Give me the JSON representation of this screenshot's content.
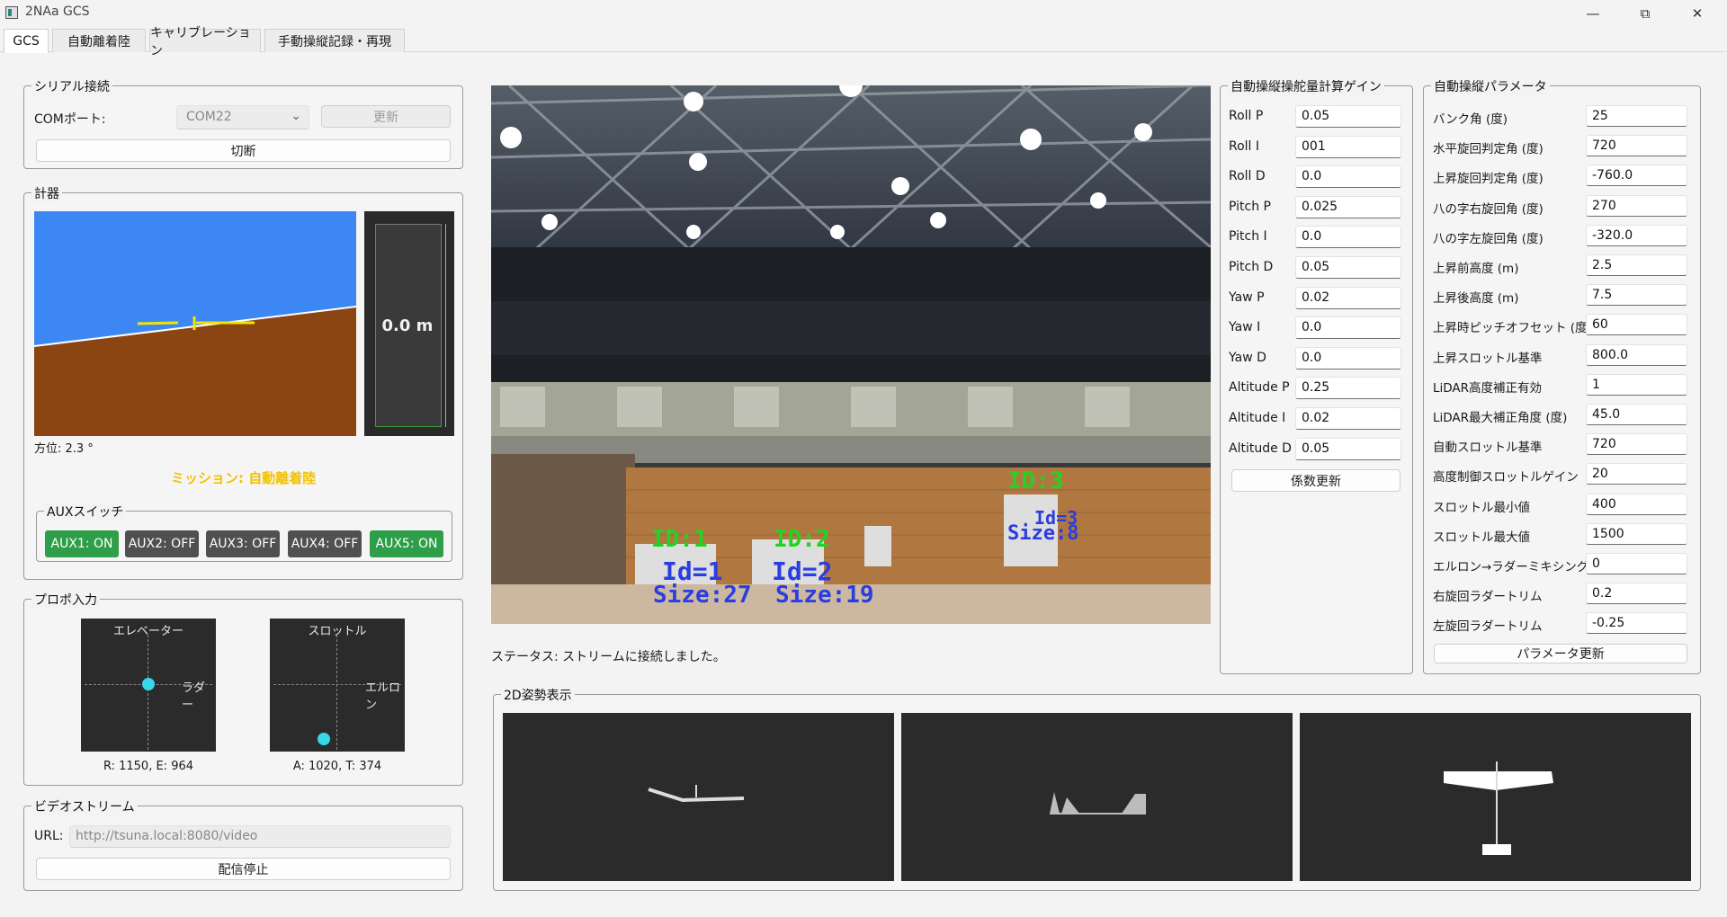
{
  "window": {
    "title": "2NAa GCS"
  },
  "tabs": [
    {
      "label": "GCS"
    },
    {
      "label": "自動離着陸"
    },
    {
      "label": "キャリブレーション"
    },
    {
      "label": "手動操縦記録・再現"
    }
  ],
  "serial": {
    "group_title": "シリアル接続",
    "com_label": "COMポート:",
    "com_value": "COM22",
    "refresh_label": "更新",
    "disconnect_label": "切断"
  },
  "instruments": {
    "group_title": "計器",
    "altitude_text": "0.0 m",
    "heading_text": "方位: 2.3 °",
    "mission_text": "ミッション: 自動離着陸",
    "colors": {
      "sky": "#3d87f5",
      "ground": "#8b4513",
      "mission": "#f2c200"
    }
  },
  "aux": {
    "group_title": "AUXスイッチ",
    "buttons": [
      {
        "label": "AUX1: ON",
        "state": "on"
      },
      {
        "label": "AUX2: OFF",
        "state": "off"
      },
      {
        "label": "AUX3: OFF",
        "state": "off"
      },
      {
        "label": "AUX4: OFF",
        "state": "off"
      },
      {
        "label": "AUX5: ON",
        "state": "on"
      }
    ]
  },
  "propo": {
    "group_title": "プロポ入力",
    "left_stick": {
      "top_label": "エレベーター",
      "side_label": "ラダー",
      "readout": "R: 1150, E: 964"
    },
    "right_stick": {
      "top_label": "スロットル",
      "side_label": "エルロン",
      "readout": "A: 1020, T: 374"
    }
  },
  "video": {
    "group_title": "ビデオストリーム",
    "url_label": "URL:",
    "url_value": "http://tsuna.local:8080/video",
    "stop_label": "配信停止"
  },
  "camera": {
    "markers": [
      {
        "id_text": "ID:1",
        "sub1": "Id=1",
        "sub2": "Size:27"
      },
      {
        "id_text": "ID:2",
        "sub1": "Id=2",
        "sub2": "Size:19"
      },
      {
        "id_text": "ID:3",
        "sub1": "Size:8",
        "sub2": "Id=3"
      }
    ],
    "status_text": "ステータス: ストリームに接続しました。"
  },
  "gains": {
    "group_title": "自動操縦操舵量計算ゲイン",
    "rows": [
      {
        "label": "Roll P",
        "value": "0.05"
      },
      {
        "label": "Roll I",
        "value": "001"
      },
      {
        "label": "Roll D",
        "value": "0.0"
      },
      {
        "label": "Pitch P",
        "value": "0.025"
      },
      {
        "label": "Pitch I",
        "value": "0.0"
      },
      {
        "label": "Pitch D",
        "value": "0.05"
      },
      {
        "label": "Yaw P",
        "value": "0.02"
      },
      {
        "label": "Yaw I",
        "value": "0.0"
      },
      {
        "label": "Yaw D",
        "value": "0.0"
      },
      {
        "label": "Altitude P",
        "value": "0.25"
      },
      {
        "label": "Altitude I",
        "value": "0.02"
      },
      {
        "label": "Altitude D",
        "value": "0.05"
      }
    ],
    "update_label": "係数更新"
  },
  "params": {
    "group_title": "自動操縦パラメータ",
    "rows": [
      {
        "label": "バンク角 (度)",
        "value": "25"
      },
      {
        "label": "水平旋回判定角 (度)",
        "value": "720"
      },
      {
        "label": "上昇旋回判定角 (度)",
        "value": "-760.0"
      },
      {
        "label": "八の字右旋回角 (度)",
        "value": "270"
      },
      {
        "label": "八の字左旋回角 (度)",
        "value": "-320.0"
      },
      {
        "label": "上昇前高度 (m)",
        "value": "2.5"
      },
      {
        "label": "上昇後高度 (m)",
        "value": "7.5"
      },
      {
        "label": "上昇時ピッチオフセット (度)",
        "value": "60"
      },
      {
        "label": "上昇スロットル基準",
        "value": "800.0"
      },
      {
        "label": "LiDAR高度補正有効",
        "value": "1"
      },
      {
        "label": "LiDAR最大補正角度 (度)",
        "value": "45.0"
      },
      {
        "label": "自動スロットル基準",
        "value": "720"
      },
      {
        "label": "高度制御スロットルゲイン",
        "value": "20"
      },
      {
        "label": "スロットル最小値",
        "value": "400"
      },
      {
        "label": "スロットル最大値",
        "value": "1500"
      },
      {
        "label": "エルロン→ラダーミキシング",
        "value": "0"
      },
      {
        "label": "右旋回ラダートリム",
        "value": "0.2"
      },
      {
        "label": "左旋回ラダートリム",
        "value": "-0.25"
      }
    ],
    "update_label": "パラメータ更新"
  },
  "attitude2d": {
    "group_title": "2D姿勢表示"
  }
}
